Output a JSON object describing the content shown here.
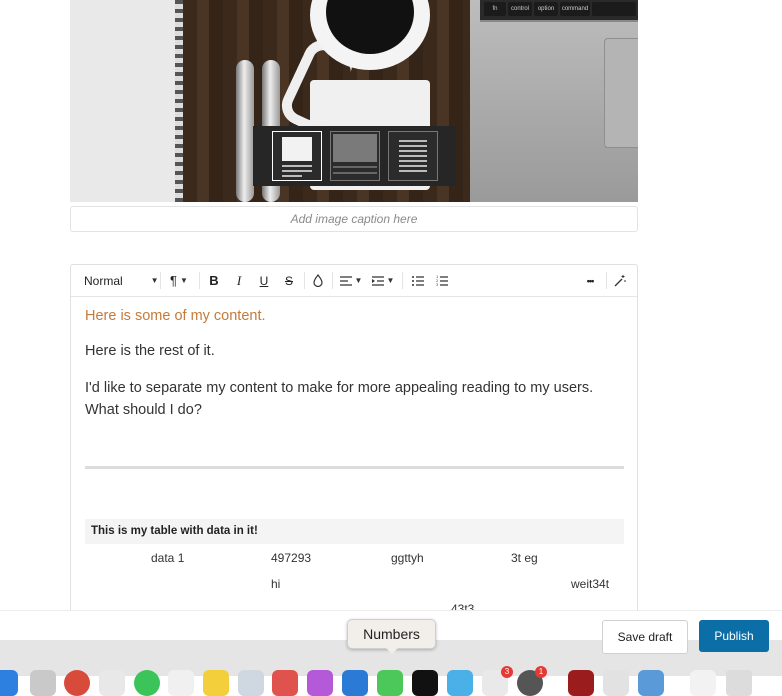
{
  "image_block": {
    "caption_placeholder": "Add image caption here",
    "keyboard_keys": [
      "fn",
      "control",
      "option",
      "command"
    ],
    "layout_options": [
      "image-centered",
      "image-wide",
      "text-beside"
    ]
  },
  "toolbar": {
    "block_style": "Normal",
    "icons": [
      "paragraph-icon",
      "bold-icon",
      "italic-icon",
      "underline-icon",
      "strikethrough-icon",
      "color-icon",
      "align-icon",
      "indent-icon",
      "bullet-list-icon",
      "numbered-list-icon",
      "more-icon",
      "magic-wand-icon"
    ],
    "labels": {
      "bold": "B",
      "italic": "I",
      "underline": "U",
      "strike": "S",
      "more": "•••"
    }
  },
  "content": {
    "highlight_paragraph": "Here is some of my content.",
    "paragraph_1": "Here is the rest of it.",
    "paragraph_2": "I'd like to separate my content to make for more appealing reading to my users. What should I do?",
    "table": {
      "caption": "This is my table with data in it!",
      "rows": [
        [
          "data 1",
          "497293",
          "ggttyh",
          "3t eg",
          ""
        ],
        [
          "",
          "hi",
          "",
          "",
          "weit34t"
        ],
        [
          "",
          "",
          "",
          "43t3",
          ""
        ]
      ]
    }
  },
  "actions": {
    "save_draft": "Save draft",
    "publish": "Publish"
  },
  "dock": {
    "tooltip": "Numbers",
    "badges": [
      "3",
      "1"
    ]
  },
  "colors": {
    "accent": "#0b6ea6",
    "highlight_text": "#c47a3a"
  }
}
